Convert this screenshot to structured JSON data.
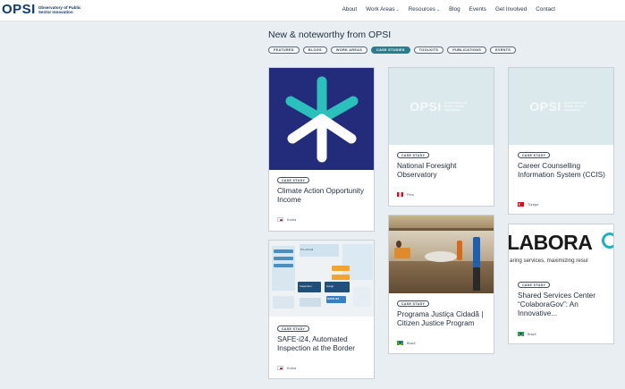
{
  "header": {
    "logo_word": "OPSI",
    "logo_sub": "Observatory of Public Sector Innovation",
    "nav": [
      {
        "label": "About",
        "dropdown": false
      },
      {
        "label": "Work Areas",
        "dropdown": true
      },
      {
        "label": "Resources",
        "dropdown": true
      },
      {
        "label": "Blog",
        "dropdown": false
      },
      {
        "label": "Events",
        "dropdown": false
      },
      {
        "label": "Get Involved",
        "dropdown": false
      },
      {
        "label": "Contact",
        "dropdown": false
      }
    ]
  },
  "section": {
    "title": "New & noteworthy from OPSI",
    "filters": [
      "FEATURED",
      "BLOGS",
      "WORK AREAS",
      "CASE STUDIES",
      "TOOLKITS",
      "PUBLICATIONS",
      "EVENTS"
    ],
    "active_filter": "CASE STUDIES"
  },
  "cards": [
    {
      "badge": "CASE STUDY",
      "title": "Climate Action Opportunity Income",
      "country": "Korea",
      "flag": "korea",
      "image": "star-logo"
    },
    {
      "badge": "CASE STUDY",
      "title": "SAFE-i24, Automated Inspection at the Border",
      "country": "Korea",
      "flag": "korea",
      "image": "diagram"
    },
    {
      "badge": "CASE STUDY",
      "title": "National Foresight Observatory",
      "country": "Peru",
      "flag": "peru",
      "image": "opsi-placeholder"
    },
    {
      "badge": "CASE STUDY",
      "title": "Programa Justiça Cidadã | Citizen Justice Program",
      "country": "Brazil",
      "flag": "brazil",
      "image": "photo"
    },
    {
      "badge": "CASE STUDY",
      "title": "Career Counselling Information System (CCIS)",
      "country": "Türkiye",
      "flag": "turkey",
      "image": "opsi-placeholder"
    },
    {
      "badge": "CASE STUDY",
      "title": "Shared Services Center “ColaboraGov”: An Innovative...",
      "country": "Brazil",
      "flag": "brazil",
      "image": "colabora-banner"
    }
  ],
  "images": {
    "placeholder_word": "OPSI",
    "placeholder_sub": "Observatory of Public Sector Innovation",
    "colabora_big": "LABORA",
    "colabora_small": "aring services, maximizing resul",
    "diagram_labels": [
      "Pre-Arrival",
      "Inspection",
      "Cargo",
      "SAFE-i24"
    ]
  },
  "colors": {
    "accent": "#2b7c8c",
    "navy": "#0f3b6b",
    "teal": "#1bb3c0",
    "star_bg": "#232c7a",
    "star_arm": "#2cc0bd"
  }
}
